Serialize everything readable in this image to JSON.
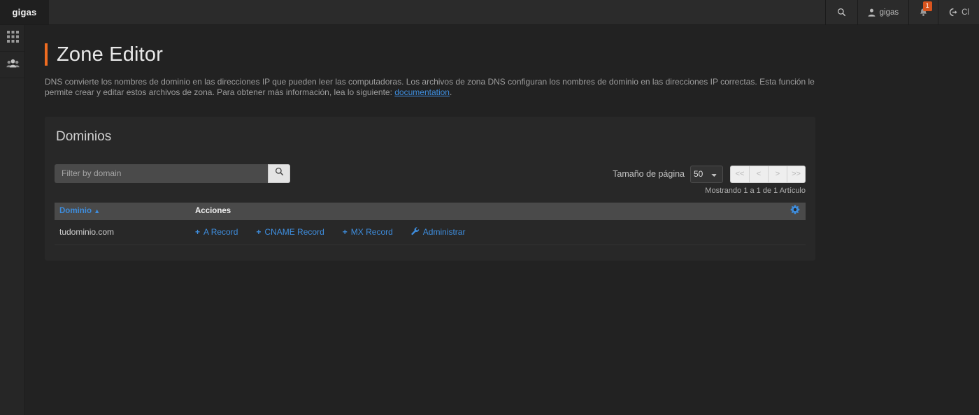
{
  "topbar": {
    "logo": "gigas",
    "search_icon": "search-icon",
    "user": {
      "label": "gigas",
      "icon": "user-icon"
    },
    "notifications": {
      "icon": "bell-icon",
      "badge": "1"
    },
    "logout": {
      "label": "Cl",
      "icon": "logout-icon"
    }
  },
  "sidebar": {
    "items": [
      {
        "name": "apps-grid",
        "icon": "grid-icon"
      },
      {
        "name": "users",
        "icon": "users-icon"
      }
    ]
  },
  "page": {
    "title": "Zone Editor",
    "accent_color": "#ef6c21",
    "description_part1": "DNS convierte los nombres de dominio en las direcciones IP que pueden leer las computadoras. Los archivos de zona DNS configuran los nombres de dominio en las direcciones IP correctas. Esta función le permite crear y editar estos archivos de zona. Para obtener más información, lea lo siguiente: ",
    "description_link": "documentation",
    "description_part2": "."
  },
  "panel": {
    "title": "Dominios",
    "search": {
      "placeholder": "Filter by domain",
      "value": "",
      "button_icon": "search-icon"
    },
    "pagination": {
      "page_size_label": "Tamaño de página",
      "page_size_value": "50",
      "page_size_options": [
        "50"
      ],
      "buttons": [
        "<<",
        "<",
        ">",
        ">>"
      ],
      "showing": "Mostrando 1 a 1 de 1 Artículo"
    },
    "table": {
      "columns": [
        {
          "label": "Dominio",
          "sort": "▲",
          "color": "#3e8ddd"
        },
        {
          "label": "Acciones",
          "sort": "",
          "color": "#efefef"
        }
      ],
      "settings_icon": "gear-icon",
      "rows": [
        {
          "domain": "tudominio.com",
          "actions": [
            {
              "label": "A Record",
              "icon": "plus-icon"
            },
            {
              "label": "CNAME Record",
              "icon": "plus-icon"
            },
            {
              "label": "MX Record",
              "icon": "plus-icon"
            },
            {
              "label": "Administrar",
              "icon": "wrench-icon"
            }
          ]
        }
      ]
    }
  }
}
